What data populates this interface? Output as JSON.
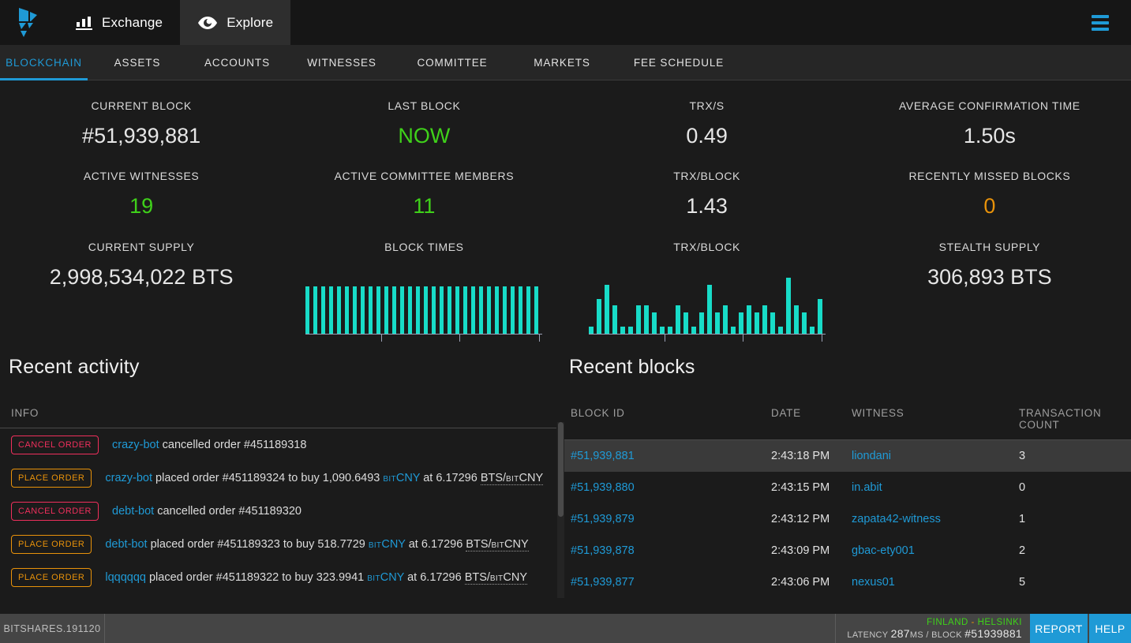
{
  "topbar": {
    "logo_name": "bitshares-logo",
    "items": [
      {
        "label": "Exchange",
        "icon": "bar-chart-icon",
        "active": false
      },
      {
        "label": "Explore",
        "icon": "eye-icon",
        "active": true
      }
    ],
    "menu_icon": "hamburger-menu-icon"
  },
  "tabs": [
    {
      "label": "BLOCKCHAIN",
      "active": true
    },
    {
      "label": "ASSETS",
      "active": false
    },
    {
      "label": "ACCOUNTS",
      "active": false
    },
    {
      "label": "WITNESSES",
      "active": false
    },
    {
      "label": "COMMITTEE",
      "active": false
    },
    {
      "label": "MARKETS",
      "active": false
    },
    {
      "label": "FEE SCHEDULE",
      "active": false
    }
  ],
  "stats": {
    "current_block": {
      "label": "CURRENT BLOCK",
      "value": "#51,939,881"
    },
    "last_block": {
      "label": "LAST BLOCK",
      "value": "NOW",
      "color": "#3fd11a"
    },
    "trx_s": {
      "label": "TRX/S",
      "value": "0.49"
    },
    "avg_confirmation": {
      "label": "AVERAGE CONFIRMATION TIME",
      "value": "1.50s"
    },
    "active_witnesses": {
      "label": "ACTIVE WITNESSES",
      "value": "19",
      "color": "#3fd11a"
    },
    "active_committee": {
      "label": "ACTIVE COMMITTEE MEMBERS",
      "value": "11",
      "color": "#3fd11a"
    },
    "trx_block": {
      "label": "TRX/BLOCK",
      "value": "1.43"
    },
    "missed_blocks": {
      "label": "RECENTLY MISSED BLOCKS",
      "value": "0",
      "color": "#e8920a"
    },
    "current_supply": {
      "label": "CURRENT SUPPLY",
      "value": "2,998,534,022 BTS"
    },
    "block_times_label": "BLOCK TIMES",
    "trx_block_chart_label": "TRX/BLOCK",
    "stealth_supply": {
      "label": "STEALTH SUPPLY",
      "value": "306,893 BTS"
    }
  },
  "chart_data": [
    {
      "type": "bar",
      "title": "BLOCK TIMES",
      "xlabel": "",
      "ylabel": "",
      "bar_color": "#18dcc8",
      "ylim": [
        0,
        4
      ],
      "grid": false,
      "values": [
        3,
        3,
        3,
        3,
        3,
        3,
        3,
        3,
        3,
        3,
        3,
        3,
        3,
        3,
        3,
        3,
        3,
        3,
        3,
        3,
        3,
        3,
        3,
        3,
        3,
        3,
        3,
        3,
        3,
        3
      ]
    },
    {
      "type": "bar",
      "title": "TRX/BLOCK",
      "xlabel": "",
      "ylabel": "",
      "bar_color": "#18dcc8",
      "ylim": [
        0,
        9
      ],
      "grid": false,
      "values": [
        1,
        5,
        7,
        4,
        1,
        1,
        4,
        4,
        3,
        1,
        1,
        4,
        3,
        1,
        3,
        7,
        3,
        4,
        1,
        3,
        4,
        3,
        4,
        3,
        1,
        8,
        4,
        3,
        1,
        5
      ]
    }
  ],
  "recent_activity": {
    "title": "Recent activity",
    "header": "INFO",
    "rows": [
      {
        "op": "CANCEL ORDER",
        "op_type": "cancel",
        "account": "crazy-bot",
        "text": " cancelled order #451189318"
      },
      {
        "op": "PLACE ORDER",
        "op_type": "place",
        "account": "crazy-bot",
        "text_a": " placed order #451189324 to buy 1,090.6493 ",
        "asset_pre": "BIT",
        "asset": "CNY",
        "text_b": " at 6.17296 ",
        "pair_a": "BTS/",
        "pair_pre": "BIT",
        "pair_b": "CNY"
      },
      {
        "op": "CANCEL ORDER",
        "op_type": "cancel",
        "account": "debt-bot",
        "text": " cancelled order #451189320"
      },
      {
        "op": "PLACE ORDER",
        "op_type": "place",
        "account": "debt-bot",
        "text_a": " placed order #451189323 to buy 518.7729 ",
        "asset_pre": "BIT",
        "asset": "CNY",
        "text_b": " at 6.17296 ",
        "pair_a": "BTS/",
        "pair_pre": "BIT",
        "pair_b": "CNY"
      },
      {
        "op": "PLACE ORDER",
        "op_type": "place",
        "account": "lqqqqqq",
        "text_a": " placed order #451189322 to buy 323.9941 ",
        "asset_pre": "BIT",
        "asset": "CNY",
        "text_b": " at 6.17296 ",
        "pair_a": "BTS/",
        "pair_pre": "BIT",
        "pair_b": "CNY"
      }
    ]
  },
  "recent_blocks": {
    "title": "Recent blocks",
    "columns": [
      "BLOCK ID",
      "DATE",
      "WITNESS",
      "TRANSACTION COUNT"
    ],
    "rows": [
      {
        "id": "#51,939,881",
        "date": "2:43:18 PM",
        "witness": "liondani",
        "tx": "3",
        "selected": true
      },
      {
        "id": "#51,939,880",
        "date": "2:43:15 PM",
        "witness": "in.abit",
        "tx": "0",
        "selected": false
      },
      {
        "id": "#51,939,879",
        "date": "2:43:12 PM",
        "witness": "zapata42-witness",
        "tx": "1",
        "selected": false
      },
      {
        "id": "#51,939,878",
        "date": "2:43:09 PM",
        "witness": "gbac-ety001",
        "tx": "2",
        "selected": false
      },
      {
        "id": "#51,939,877",
        "date": "2:43:06 PM",
        "witness": "nexus01",
        "tx": "5",
        "selected": false
      }
    ]
  },
  "statusbar": {
    "version": "BITSHARES.191120",
    "node_location": "FINLAND",
    "node_dash": "-",
    "node_city": "HELSINKI",
    "latency_label": "LATENCY",
    "latency_value": "287",
    "latency_unit": "MS",
    "sep": "/",
    "block_label": "BLOCK",
    "block_value": "#51939881",
    "report_label": "REPORT",
    "help_label": "HELP"
  },
  "colors": {
    "accent": "#1f9ad6",
    "green": "#3fd11a",
    "orange": "#e8920a",
    "red": "#ef2f5c",
    "teal": "#18dcc8"
  }
}
